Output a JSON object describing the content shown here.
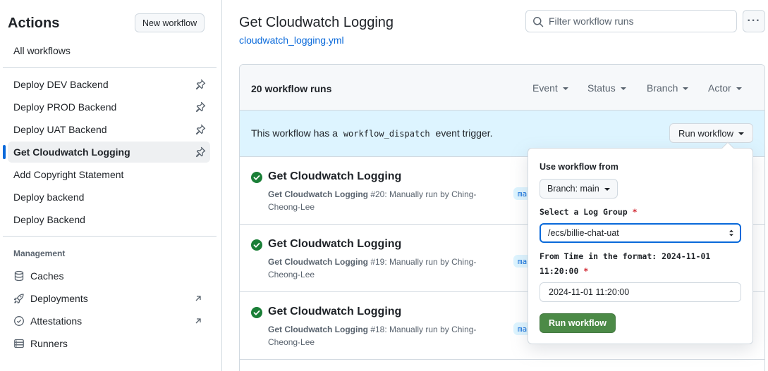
{
  "sidebar": {
    "title": "Actions",
    "new_workflow_label": "New workflow",
    "all_workflows_label": "All workflows",
    "workflows": [
      {
        "label": "Deploy DEV Backend",
        "pinned": true
      },
      {
        "label": "Deploy PROD Backend",
        "pinned": true
      },
      {
        "label": "Deploy UAT Backend",
        "pinned": true
      },
      {
        "label": "Get Cloudwatch Logging",
        "pinned": true,
        "active": true
      },
      {
        "label": "Add Copyright Statement",
        "pinned": false
      },
      {
        "label": "Deploy backend",
        "pinned": false
      },
      {
        "label": "Deploy Backend",
        "pinned": false
      }
    ],
    "management_heading": "Management",
    "management_items": [
      {
        "label": "Caches",
        "icon": "database-icon"
      },
      {
        "label": "Deployments",
        "icon": "rocket-icon",
        "external": true
      },
      {
        "label": "Attestations",
        "icon": "verified-icon",
        "external": true
      },
      {
        "label": "Runners",
        "icon": "server-icon"
      }
    ]
  },
  "main": {
    "title": "Get Cloudwatch Logging",
    "file": "cloudwatch_logging.yml",
    "filter_placeholder": "Filter workflow runs",
    "more_label": "···",
    "runs_count": "20 workflow runs",
    "filters": [
      "Event",
      "Status",
      "Branch",
      "Actor"
    ],
    "dispatch_before": "This workflow has a",
    "dispatch_code": "workflow_dispatch",
    "dispatch_after": "event trigger.",
    "run_workflow_label": "Run workflow",
    "runs": [
      {
        "title": "Get Cloudwatch Logging",
        "workflow": "Get Cloudwatch Logging",
        "number": "#20",
        "detail": ": Manually run by Ching-Cheong-Lee",
        "branch": "main"
      },
      {
        "title": "Get Cloudwatch Logging",
        "workflow": "Get Cloudwatch Logging",
        "number": "#19",
        "detail": ": Manually run by Ching-Cheong-Lee",
        "branch": "main"
      },
      {
        "title": "Get Cloudwatch Logging",
        "workflow": "Get Cloudwatch Logging",
        "number": "#18",
        "detail": ": Manually run by Ching-Cheong-Lee",
        "branch": "main"
      }
    ]
  },
  "popover": {
    "use_from_label": "Use workflow from",
    "branch_label": "Branch: main",
    "log_group_label": "Select a Log Group",
    "required_mark": "*",
    "log_group_value": "/ecs/billie-chat-uat",
    "from_time_label": "From Time in the format: 2024-11-01 11:20:00",
    "from_time_value": "2024-11-01 11:20:00",
    "submit_label": "Run workflow"
  },
  "colors": {
    "accent": "#0969da",
    "success": "#1a7f37",
    "submit": "#4c8a47",
    "required": "#d1242f",
    "dispatch_bg": "#ddf4ff"
  }
}
